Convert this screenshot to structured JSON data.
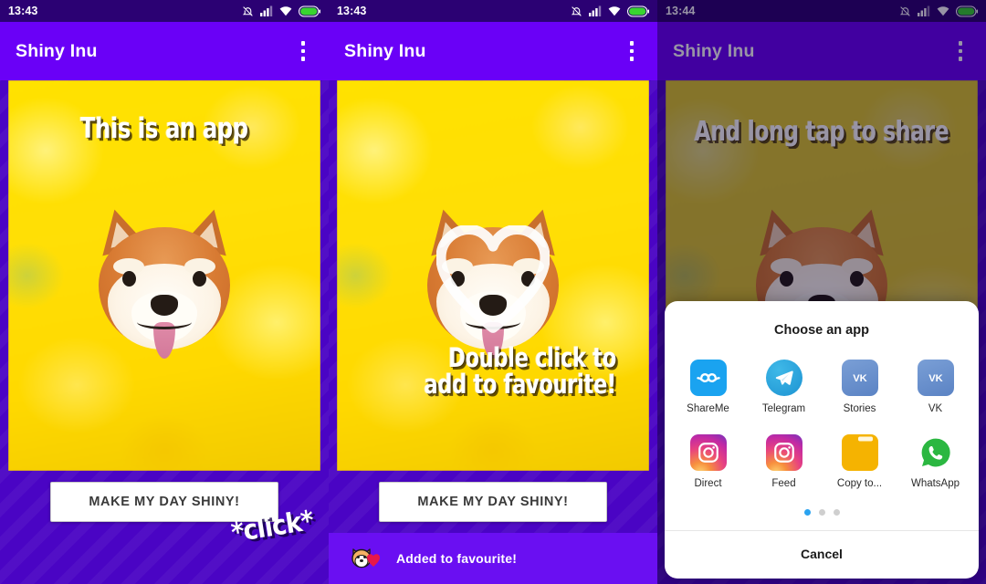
{
  "panels": [
    {
      "status": {
        "time": "13:43",
        "icons": [
          "bell-muted-icon",
          "signal-icon",
          "wifi-icon",
          "battery-icon"
        ]
      },
      "appbar": {
        "title": "Shiny Inu",
        "overflow": "overflow-menu-icon"
      },
      "caption_top": "This is an app",
      "cta_label": "MAKE MY DAY SHINY!",
      "annotation": "*click*"
    },
    {
      "status": {
        "time": "13:43"
      },
      "appbar": {
        "title": "Shiny Inu"
      },
      "caption_bottom_line1": "Double click to",
      "caption_bottom_line2": "add to favourite!",
      "cta_label": "MAKE MY DAY SHINY!",
      "snackbar": {
        "emoji": "dog-face-with-heart-icon",
        "text": "Added to favourite!"
      }
    },
    {
      "status": {
        "time": "13:44"
      },
      "appbar": {
        "title": "Shiny Inu"
      },
      "caption_top": "And long tap to share",
      "sheet": {
        "title": "Choose an app",
        "apps": [
          {
            "label": "ShareMe",
            "icon": "shareme-icon"
          },
          {
            "label": "Telegram",
            "icon": "telegram-icon"
          },
          {
            "label": "Stories",
            "icon": "vk-stories-icon"
          },
          {
            "label": "VK",
            "icon": "vk-icon"
          },
          {
            "label": "Direct",
            "icon": "instagram-direct-icon"
          },
          {
            "label": "Feed",
            "icon": "instagram-feed-icon"
          },
          {
            "label": "Copy to...",
            "icon": "folder-copy-icon"
          },
          {
            "label": "WhatsApp",
            "icon": "whatsapp-icon"
          }
        ],
        "page_dots": {
          "count": 3,
          "active": 1
        },
        "cancel_label": "Cancel"
      }
    }
  ],
  "colors": {
    "app_bar": "#6a00f7",
    "background": "#4a04c4",
    "status_bar": "#2b0173",
    "snackbar": "#6a0ff2",
    "accent_dot": "#2aa3f0",
    "battery": "#38d430"
  }
}
